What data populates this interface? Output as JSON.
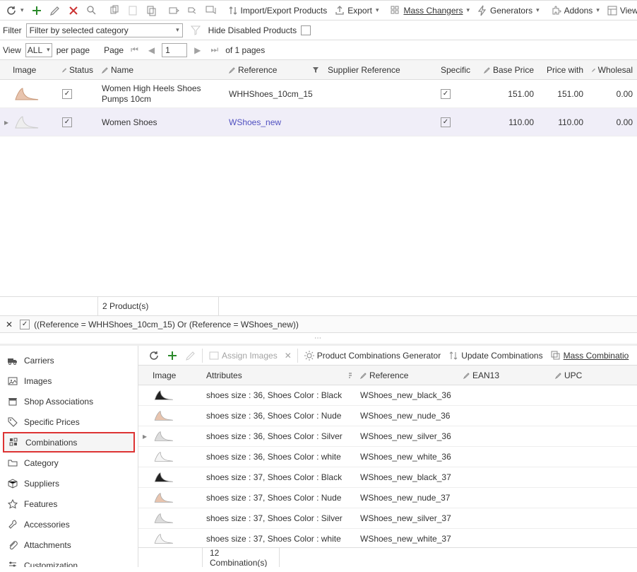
{
  "toolbar": {
    "import_export": "Import/Export Products",
    "export": "Export",
    "mass": "Mass Changers",
    "gen": "Generators",
    "addons": "Addons",
    "view": "View"
  },
  "filter": {
    "label": "Filter",
    "combo": "Filter by selected category",
    "hide": "Hide Disabled Products"
  },
  "pager": {
    "view": "View",
    "all": "ALL",
    "perpage": "per page",
    "page": "Page",
    "current": "1",
    "total": "of 1 pages"
  },
  "cols": {
    "image": "Image",
    "status": "Status",
    "name": "Name",
    "reference": "Reference",
    "supplier": "Supplier Reference",
    "specific": "Specific",
    "base": "Base Price",
    "price": "Price with",
    "wholesale": "Wholesal"
  },
  "rows": [
    {
      "name": "Women High Heels Shoes Pumps 10cm",
      "ref": "WHHShoes_10cm_15",
      "base": "151.00",
      "price": "151.00",
      "whole": "0.00",
      "link": false
    },
    {
      "name": "Women Shoes",
      "ref": "WShoes_new",
      "base": "110.00",
      "price": "110.00",
      "whole": "0.00",
      "link": true
    }
  ],
  "status": {
    "count": "2 Product(s)"
  },
  "filter_expr": "((Reference = WHHShoes_10cm_15) Or (Reference = WShoes_new))",
  "sidebar": [
    "Carriers",
    "Images",
    "Shop Associations",
    "Specific Prices",
    "Combinations",
    "Category",
    "Suppliers",
    "Features",
    "Accessories",
    "Attachments",
    "Customization"
  ],
  "bt": {
    "assign": "Assign Images",
    "pcg": "Product Combinations Generator",
    "update": "Update Combinations",
    "massc": "Mass Combinatio"
  },
  "cols2": {
    "image": "Image",
    "attr": "Attributes",
    "ref": "Reference",
    "ean": "EAN13",
    "upc": "UPC"
  },
  "combos": [
    {
      "attr": "shoes size : 36, Shoes Color : Black",
      "ref": "WShoes_new_black_36"
    },
    {
      "attr": "shoes size : 36, Shoes Color : Nude",
      "ref": "WShoes_new_nude_36"
    },
    {
      "attr": "shoes size : 36, Shoes Color : Silver",
      "ref": "WShoes_new_silver_36"
    },
    {
      "attr": "shoes size : 36, Shoes Color : white",
      "ref": "WShoes_new_white_36"
    },
    {
      "attr": "shoes size : 37, Shoes Color : Black",
      "ref": "WShoes_new_black_37"
    },
    {
      "attr": "shoes size : 37, Shoes Color : Nude",
      "ref": "WShoes_new_nude_37"
    },
    {
      "attr": "shoes size : 37, Shoes Color : Silver",
      "ref": "WShoes_new_silver_37"
    },
    {
      "attr": "shoes size : 37, Shoes Color : white",
      "ref": "WShoes_new_white_37"
    }
  ],
  "status2": {
    "count": "12 Combination(s)"
  }
}
